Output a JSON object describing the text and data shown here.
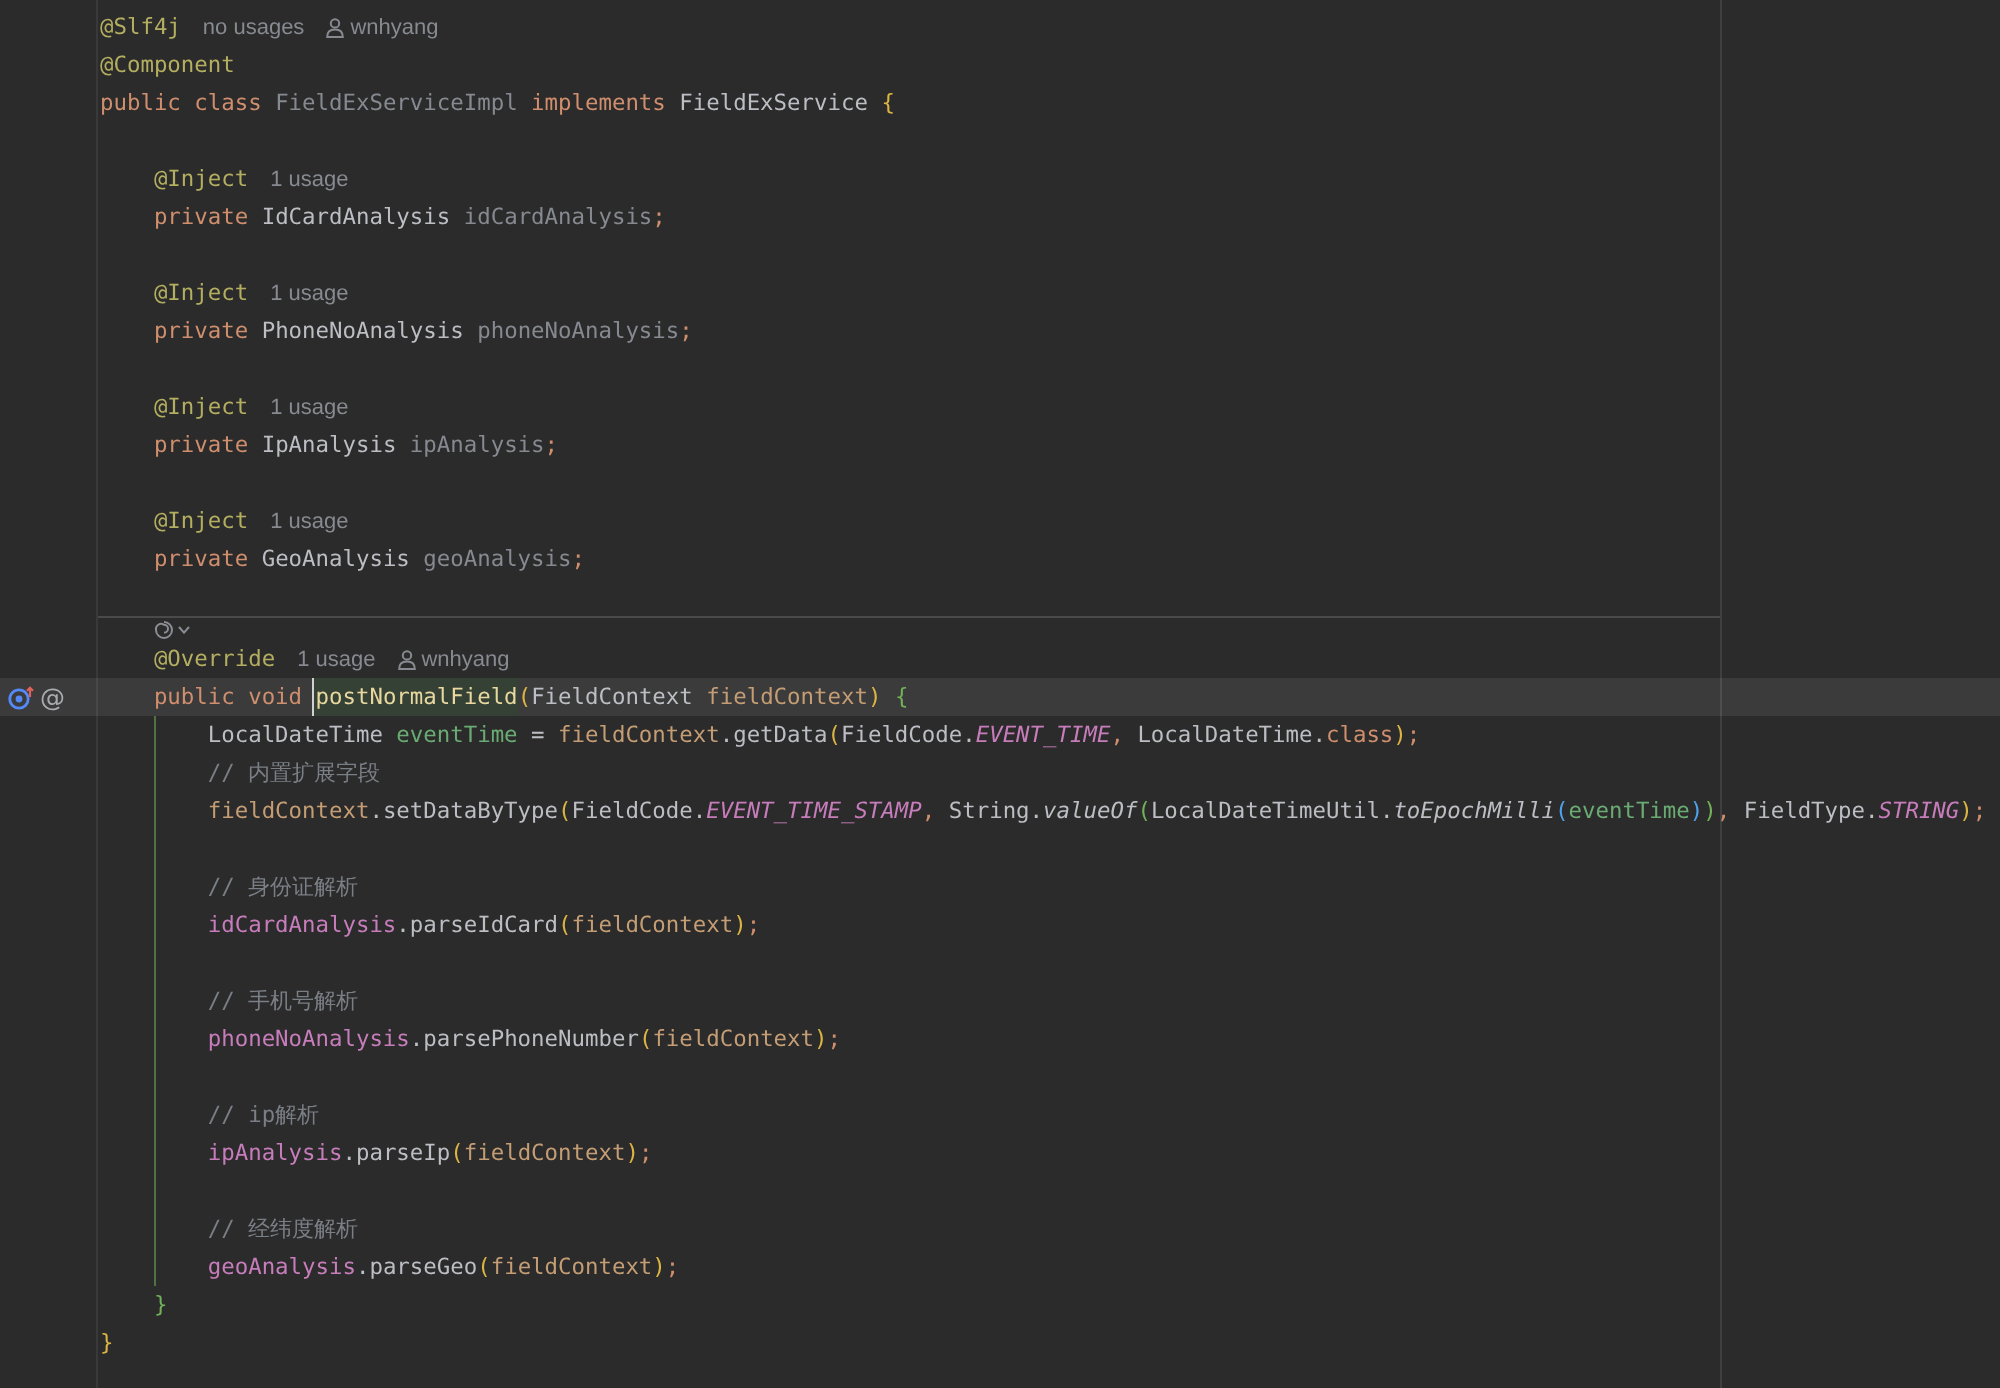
{
  "editor": {
    "lines": [
      {
        "kind": "code",
        "current": false,
        "tokens": [
          {
            "text": "@Slf4j",
            "kind": "annotation"
          }
        ],
        "hints": [
          {
            "kind": "usages",
            "text": "no usages"
          },
          {
            "kind": "author",
            "text": "wnhyang"
          }
        ]
      },
      {
        "kind": "code",
        "current": false,
        "tokens": [
          {
            "text": "@Component",
            "kind": "annotation"
          }
        ]
      },
      {
        "kind": "code",
        "current": false,
        "tokens": [
          {
            "text": "public class ",
            "kind": "keyword"
          },
          {
            "text": "FieldExServiceImpl",
            "kind": "muted"
          },
          {
            "text": " implements ",
            "kind": "keyword"
          },
          {
            "text": "FieldExService ",
            "kind": "type"
          },
          {
            "text": "{",
            "kind": "bracket1"
          }
        ],
        "children": [
          {
            "kind": "blank",
            "current": false
          },
          {
            "kind": "code",
            "current": false,
            "tokens": [
              {
                "text": "@Inject",
                "kind": "annotation"
              }
            ],
            "hints": [
              {
                "kind": "usages",
                "text": "1 usage"
              }
            ]
          },
          {
            "kind": "code",
            "current": false,
            "tokens": [
              {
                "text": "private ",
                "kind": "keyword"
              },
              {
                "text": "IdCardAnalysis ",
                "kind": "type"
              },
              {
                "text": "idCardAnalysis",
                "kind": "muted"
              },
              {
                "text": ";",
                "kind": "punct"
              }
            ]
          },
          {
            "kind": "blank",
            "current": false
          },
          {
            "kind": "code",
            "current": false,
            "tokens": [
              {
                "text": "@Inject",
                "kind": "annotation"
              }
            ],
            "hints": [
              {
                "kind": "usages",
                "text": "1 usage"
              }
            ]
          },
          {
            "kind": "code",
            "current": false,
            "tokens": [
              {
                "text": "private ",
                "kind": "keyword"
              },
              {
                "text": "PhoneNoAnalysis ",
                "kind": "type"
              },
              {
                "text": "phoneNoAnalysis",
                "kind": "muted"
              },
              {
                "text": ";",
                "kind": "punct"
              }
            ]
          },
          {
            "kind": "blank",
            "current": false
          },
          {
            "kind": "code",
            "current": false,
            "tokens": [
              {
                "text": "@Inject",
                "kind": "annotation"
              }
            ],
            "hints": [
              {
                "kind": "usages",
                "text": "1 usage"
              }
            ]
          },
          {
            "kind": "code",
            "current": false,
            "tokens": [
              {
                "text": "private ",
                "kind": "keyword"
              },
              {
                "text": "IpAnalysis ",
                "kind": "type"
              },
              {
                "text": "ipAnalysis",
                "kind": "muted"
              },
              {
                "text": ";",
                "kind": "punct"
              }
            ]
          },
          {
            "kind": "blank",
            "current": false
          },
          {
            "kind": "code",
            "current": false,
            "tokens": [
              {
                "text": "@Inject",
                "kind": "annotation"
              }
            ],
            "hints": [
              {
                "kind": "usages",
                "text": "1 usage"
              }
            ]
          },
          {
            "kind": "code",
            "current": false,
            "tokens": [
              {
                "text": "private ",
                "kind": "keyword"
              },
              {
                "text": "GeoAnalysis ",
                "kind": "type"
              },
              {
                "text": "geoAnalysis",
                "kind": "muted"
              },
              {
                "text": ";",
                "kind": "punct"
              }
            ]
          },
          {
            "kind": "blank",
            "current": false
          },
          {
            "kind": "inlay",
            "current": false
          },
          {
            "kind": "code",
            "current": false,
            "tokens": [
              {
                "text": "@Override",
                "kind": "annotation"
              }
            ],
            "hints": [
              {
                "kind": "usages",
                "text": "1 usage"
              },
              {
                "kind": "author",
                "text": "wnhyang"
              }
            ]
          },
          {
            "kind": "code",
            "current": true,
            "gutter": [
              {
                "kind": "override"
              },
              {
                "kind": "symbol",
                "text": "@"
              }
            ],
            "tokens": [
              {
                "text": "public void ",
                "kind": "keyword"
              },
              {
                "text": "postNormalField",
                "kind": "focus"
              },
              {
                "text": "(",
                "kind": "bracket1"
              },
              {
                "text": "FieldContext ",
                "kind": "type"
              },
              {
                "text": "fieldContext",
                "kind": "param"
              },
              {
                "text": ")",
                "kind": "bracket1"
              },
              {
                "text": " {",
                "kind": "bracket2"
              }
            ],
            "children": [
              {
                "kind": "code",
                "current": false,
                "tokens": [
                  {
                    "text": "LocalDateTime ",
                    "kind": "type"
                  },
                  {
                    "text": "eventTime",
                    "kind": "local"
                  },
                  {
                    "text": " = ",
                    "kind": "plain"
                  },
                  {
                    "text": "fieldContext",
                    "kind": "param"
                  },
                  {
                    "text": ".getData",
                    "kind": "plain"
                  },
                  {
                    "text": "(",
                    "kind": "bracket1"
                  },
                  {
                    "text": "FieldCode.",
                    "kind": "plain"
                  },
                  {
                    "text": "EVENT_TIME",
                    "kind": "static"
                  },
                  {
                    "text": ", ",
                    "kind": "punct"
                  },
                  {
                    "text": "LocalDateTime.",
                    "kind": "plain"
                  },
                  {
                    "text": "class",
                    "kind": "keyword"
                  },
                  {
                    "text": ")",
                    "kind": "bracket1"
                  },
                  {
                    "text": ";",
                    "kind": "punct"
                  }
                ]
              },
              {
                "kind": "code",
                "current": false,
                "tokens": [
                  {
                    "text": "// 内置扩展字段",
                    "kind": "comment"
                  }
                ]
              },
              {
                "kind": "code",
                "current": false,
                "tokens": [
                  {
                    "text": "fieldContext",
                    "kind": "param"
                  },
                  {
                    "text": ".setDataByType",
                    "kind": "plain"
                  },
                  {
                    "text": "(",
                    "kind": "bracket1"
                  },
                  {
                    "text": "FieldCode.",
                    "kind": "plain"
                  },
                  {
                    "text": "EVENT_TIME_STAMP",
                    "kind": "static"
                  },
                  {
                    "text": ", ",
                    "kind": "punct"
                  },
                  {
                    "text": "String.",
                    "kind": "plain"
                  },
                  {
                    "text": "valueOf",
                    "kind": "call"
                  },
                  {
                    "text": "(",
                    "kind": "bracket2"
                  },
                  {
                    "text": "LocalDateTimeUtil.",
                    "kind": "plain"
                  },
                  {
                    "text": "toEpochMilli",
                    "kind": "call"
                  },
                  {
                    "text": "(",
                    "kind": "bracket3"
                  },
                  {
                    "text": "eventTime",
                    "kind": "local"
                  },
                  {
                    "text": ")",
                    "kind": "bracket3"
                  },
                  {
                    "text": ")",
                    "kind": "bracket2"
                  },
                  {
                    "text": ", ",
                    "kind": "punct"
                  },
                  {
                    "text": "FieldType.",
                    "kind": "plain"
                  },
                  {
                    "text": "STRING",
                    "kind": "static"
                  },
                  {
                    "text": ")",
                    "kind": "bracket1"
                  },
                  {
                    "text": ";",
                    "kind": "punct"
                  }
                ]
              },
              {
                "kind": "blank",
                "current": false
              },
              {
                "kind": "code",
                "current": false,
                "tokens": [
                  {
                    "text": "// 身份证解析",
                    "kind": "comment"
                  }
                ]
              },
              {
                "kind": "code",
                "current": false,
                "tokens": [
                  {
                    "text": "idCardAnalysis",
                    "kind": "field"
                  },
                  {
                    "text": ".parseIdCard",
                    "kind": "plain"
                  },
                  {
                    "text": "(",
                    "kind": "bracket1"
                  },
                  {
                    "text": "fieldContext",
                    "kind": "param"
                  },
                  {
                    "text": ")",
                    "kind": "bracket1"
                  },
                  {
                    "text": ";",
                    "kind": "punct"
                  }
                ]
              },
              {
                "kind": "blank",
                "current": false
              },
              {
                "kind": "code",
                "current": false,
                "tokens": [
                  {
                    "text": "// 手机号解析",
                    "kind": "comment"
                  }
                ]
              },
              {
                "kind": "code",
                "current": false,
                "tokens": [
                  {
                    "text": "phoneNoAnalysis",
                    "kind": "field"
                  },
                  {
                    "text": ".parsePhoneNumber",
                    "kind": "plain"
                  },
                  {
                    "text": "(",
                    "kind": "bracket1"
                  },
                  {
                    "text": "fieldContext",
                    "kind": "param"
                  },
                  {
                    "text": ")",
                    "kind": "bracket1"
                  },
                  {
                    "text": ";",
                    "kind": "punct"
                  }
                ]
              },
              {
                "kind": "blank",
                "current": false
              },
              {
                "kind": "code",
                "current": false,
                "tokens": [
                  {
                    "text": "// ip解析",
                    "kind": "comment"
                  }
                ]
              },
              {
                "kind": "code",
                "current": false,
                "tokens": [
                  {
                    "text": "ipAnalysis",
                    "kind": "field"
                  },
                  {
                    "text": ".parseIp",
                    "kind": "plain"
                  },
                  {
                    "text": "(",
                    "kind": "bracket1"
                  },
                  {
                    "text": "fieldContext",
                    "kind": "param"
                  },
                  {
                    "text": ")",
                    "kind": "bracket1"
                  },
                  {
                    "text": ";",
                    "kind": "punct"
                  }
                ]
              },
              {
                "kind": "blank",
                "current": false
              },
              {
                "kind": "code",
                "current": false,
                "tokens": [
                  {
                    "text": "// 经纬度解析",
                    "kind": "comment"
                  }
                ]
              },
              {
                "kind": "code",
                "current": false,
                "tokens": [
                  {
                    "text": "geoAnalysis",
                    "kind": "field"
                  },
                  {
                    "text": ".parseGeo",
                    "kind": "plain"
                  },
                  {
                    "text": "(",
                    "kind": "bracket1"
                  },
                  {
                    "text": "fieldContext",
                    "kind": "param"
                  },
                  {
                    "text": ")",
                    "kind": "bracket1"
                  },
                  {
                    "text": ";",
                    "kind": "punct"
                  }
                ]
              }
            ],
            "closing": {
              "kind": "code",
              "current": false,
              "tokens": [
                {
                  "text": "}",
                  "kind": "bracket2"
                }
              ]
            }
          }
        ],
        "closing": {
          "kind": "code",
          "current": false,
          "tokens": [
            {
              "text": "}",
              "kind": "bracket1"
            }
          ]
        }
      }
    ]
  }
}
